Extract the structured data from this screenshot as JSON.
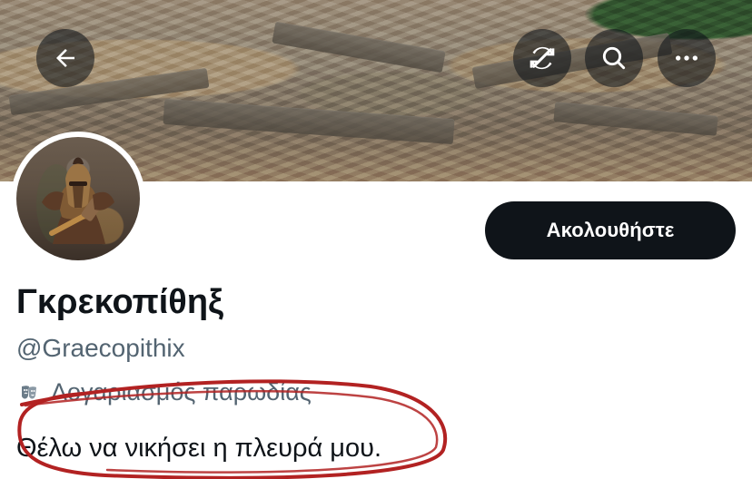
{
  "profile": {
    "display_name": "Γκρεκοπίθηξ",
    "handle": "@Graecopithix",
    "label": "Λογαριασμός παρωδίας",
    "bio": "Θέλω να νικήσει η πλευρά μου."
  },
  "actions": {
    "follow_label": "Ακολουθήστε"
  },
  "icons": {
    "back": "back-arrow-icon",
    "sync": "sync-off-icon",
    "search": "search-icon",
    "more": "more-horizontal-icon",
    "parody": "parody-mask-icon"
  },
  "colors": {
    "primary_text": "#0f1419",
    "secondary_text": "#536471",
    "button_bg": "#0f1419",
    "button_text": "#ffffff",
    "annotation_red": "#b22222"
  }
}
